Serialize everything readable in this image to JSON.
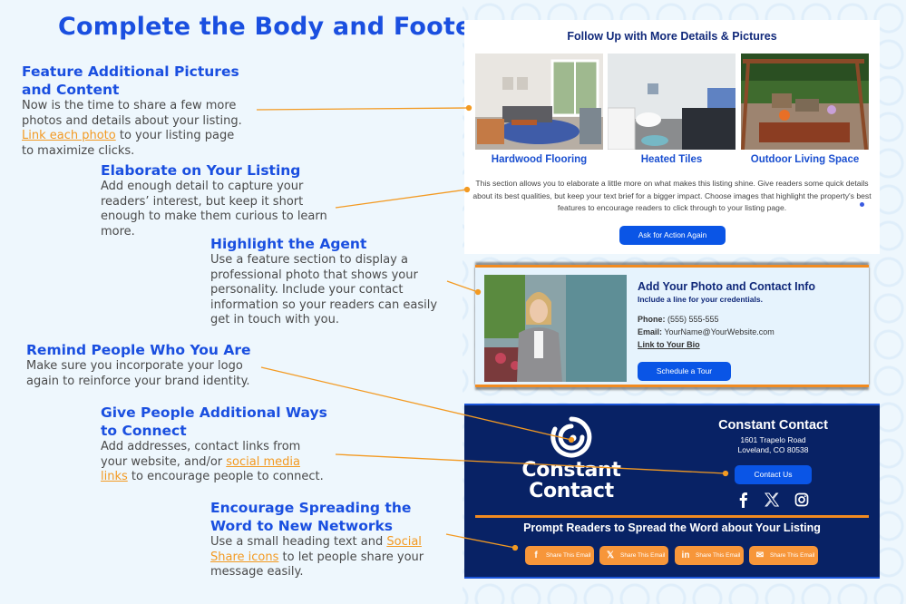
{
  "page": {
    "title": "Complete the Body and Footer"
  },
  "tips": [
    {
      "heading": "Feature Additional Pictures and Content",
      "text_before": "Now is the time to share a few more photos and details about your listing.",
      "link": "Link each photo",
      "text_after": "to your listing page to maximize clicks."
    },
    {
      "heading": "Elaborate on Your Listing",
      "text": "Add enough detail to capture your readers’ interest, but keep it short enough to make them curious to learn more."
    },
    {
      "heading": "Highlight the Agent",
      "text": "Use a feature section to display a professional photo that shows your personality. Include your contact information so your readers can easily get in touch with you."
    },
    {
      "heading": "Remind People Who You Are",
      "text": "Make sure you incorporate your logo again to reinforce your brand identity."
    },
    {
      "heading": "Give People Additional Ways to Connect",
      "text_before": "Add addresses, contact links from your website, and/or",
      "link": "social media links",
      "text_after": "to encourage people to connect."
    },
    {
      "heading": "Encourage Spreading the Word to New Networks",
      "text_before": "Use a small heading text and",
      "link": "Social Share icons",
      "text_after": "to let people share your message easily."
    }
  ],
  "email": {
    "details": {
      "heading": "Follow Up with More Details & Pictures",
      "photos": [
        {
          "caption": "Hardwood Flooring",
          "image": "living-room-photo"
        },
        {
          "caption": "Heated Tiles",
          "image": "bathroom-photo"
        },
        {
          "caption": "Outdoor Living Space",
          "image": "patio-photo"
        }
      ],
      "body": "This section allows you to elaborate a little more on what makes this listing shine. Give readers some quick details about its best qualities, but keep your text brief for a bigger impact. Choose images that highlight the property's best features to encourage readers to click through to your listing page.",
      "cta": "Ask for Action Again"
    },
    "agent": {
      "heading": "Add Your Photo and Contact Info",
      "subheading": "Include a line for your credentials.",
      "phone_label": "Phone:",
      "phone": "(555) 555-555",
      "email_label": "Email:",
      "email": "YourName@YourWebsite.com",
      "bio_link": "Link to Your Bio",
      "cta": "Schedule a Tour"
    },
    "footer": {
      "logo_line1": "Constant",
      "logo_line2": "Contact",
      "company": "Constant Contact",
      "address_line1": "1601 Trapelo Road",
      "address_line2": "Loveland, CO 80538",
      "contact_button": "Contact Us",
      "social_icons": [
        "facebook-icon",
        "x-icon",
        "instagram-icon"
      ],
      "share_heading": "Prompt Readers to Spread the Word about Your Listing",
      "share_buttons": [
        {
          "icon": "facebook-icon",
          "glyph": "f",
          "label": "Share This Email"
        },
        {
          "icon": "x-icon",
          "glyph": "𝕏",
          "label": "Share This Email"
        },
        {
          "icon": "linkedin-icon",
          "glyph": "in",
          "label": "Share This Email"
        },
        {
          "icon": "mail-icon",
          "glyph": "✉",
          "label": "Share This Email"
        }
      ]
    }
  },
  "colors": {
    "heading_blue": "#1a4fe0",
    "accent_orange": "#f28b20",
    "navy": "#082265",
    "button_blue": "#0a55e6"
  }
}
